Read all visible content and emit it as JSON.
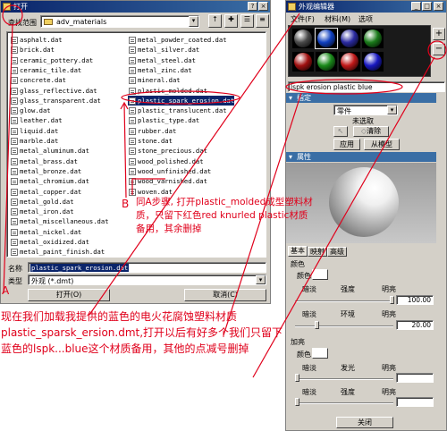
{
  "open_dialog": {
    "title": "打开",
    "look_in_label": "查找范围",
    "folder": "adv_materials",
    "files_col1": [
      "asphalt.dat",
      "brick.dat",
      "ceramic_pottery.dat",
      "ceramic_tile.dat",
      "concrete.dat",
      "glass_reflective.dat",
      "glass_transparent.dat",
      "glow.dat",
      "leather.dat",
      "liquid.dat",
      "marble.dat",
      "metal_aluminum.dat",
      "metal_brass.dat",
      "metal_bronze.dat",
      "metal_chromium.dat",
      "metal_copper.dat",
      "metal_gold.dat",
      "metal_iron.dat",
      "metal_miscellaneous.dat",
      "metal_nickel.dat",
      "metal_oxidized.dat",
      "metal_paint_finish.dat"
    ],
    "files_col2": [
      "metal_powder_coated.dat",
      "metal_silver.dat",
      "metal_steel.dat",
      "metal_zinc.dat",
      "mineral.dat",
      "plastic_molded.dat",
      "plastic_spark_erosion.dat",
      "plastic_translucent.dat",
      "plastic_type.dat",
      "rubber.dat",
      "stone.dat",
      "stone_precious.dat",
      "wood_polished.dat",
      "wood_unfinished.dat",
      "wood_varnished.dat",
      "woven.dat"
    ],
    "filename_label": "名称",
    "filename_value": "plastic_spark_erosion.dat",
    "type_label": "类型",
    "type_value": "外观 (*.dmt)",
    "open_button": "打开(O)",
    "cancel_button": "取消(C)"
  },
  "appearance_editor": {
    "title": "外观编辑器",
    "menu": [
      "文件(F)",
      "材料(M)",
      "选项"
    ],
    "add_button": "+",
    "remove_button": "−",
    "selected_material": "lspk erosion plastic blue",
    "assign_section": "指定",
    "component_dropdown": "零件",
    "unselected_text": "未选取",
    "clear_button": "清除",
    "apply_button": "应用",
    "from_model_button": "从模型",
    "properties_section": "属性",
    "tabs": [
      "基本",
      "映射",
      "高级"
    ],
    "color_group": "颜色",
    "color_label": "颜色",
    "row1_labels": [
      "暗淡",
      "强度",
      "明亮"
    ],
    "row1_value": "100.00",
    "row2_labels": [
      "暗淡",
      "环境",
      "明亮"
    ],
    "row2_value": "20.00",
    "highlight_group": "加亮",
    "highlight_color_label": "颜色",
    "row3_labels": [
      "暗淡",
      "发光",
      "明亮"
    ],
    "row4_labels": [
      "暗淡",
      "强度",
      "明亮"
    ],
    "close_button": "关闭",
    "colors": {
      "swatch_row1": [
        "#4a4a4a",
        "#1040c0",
        "#2a2aa0",
        "#1a7a1a"
      ],
      "swatch_row2": [
        "#a01010",
        "#1a8a1a",
        "#c01818",
        "#1818c0"
      ]
    }
  },
  "annotations": {
    "label_A": "A",
    "label_B": "B",
    "text_B": "同A步骤, 打开plastic_molded成型塑料材质，只留下红色red knurled plastic材质备用，其余删掉",
    "text_A": "现在我们加载我提供的蓝色的电火花腐蚀塑料材质plastic_sparsk_ersion.dmt,打开以后有好多个我们只留下蓝色的lspk...blue这个材质备用，其他的点减号删掉",
    "accent_color": "#e0001b"
  }
}
